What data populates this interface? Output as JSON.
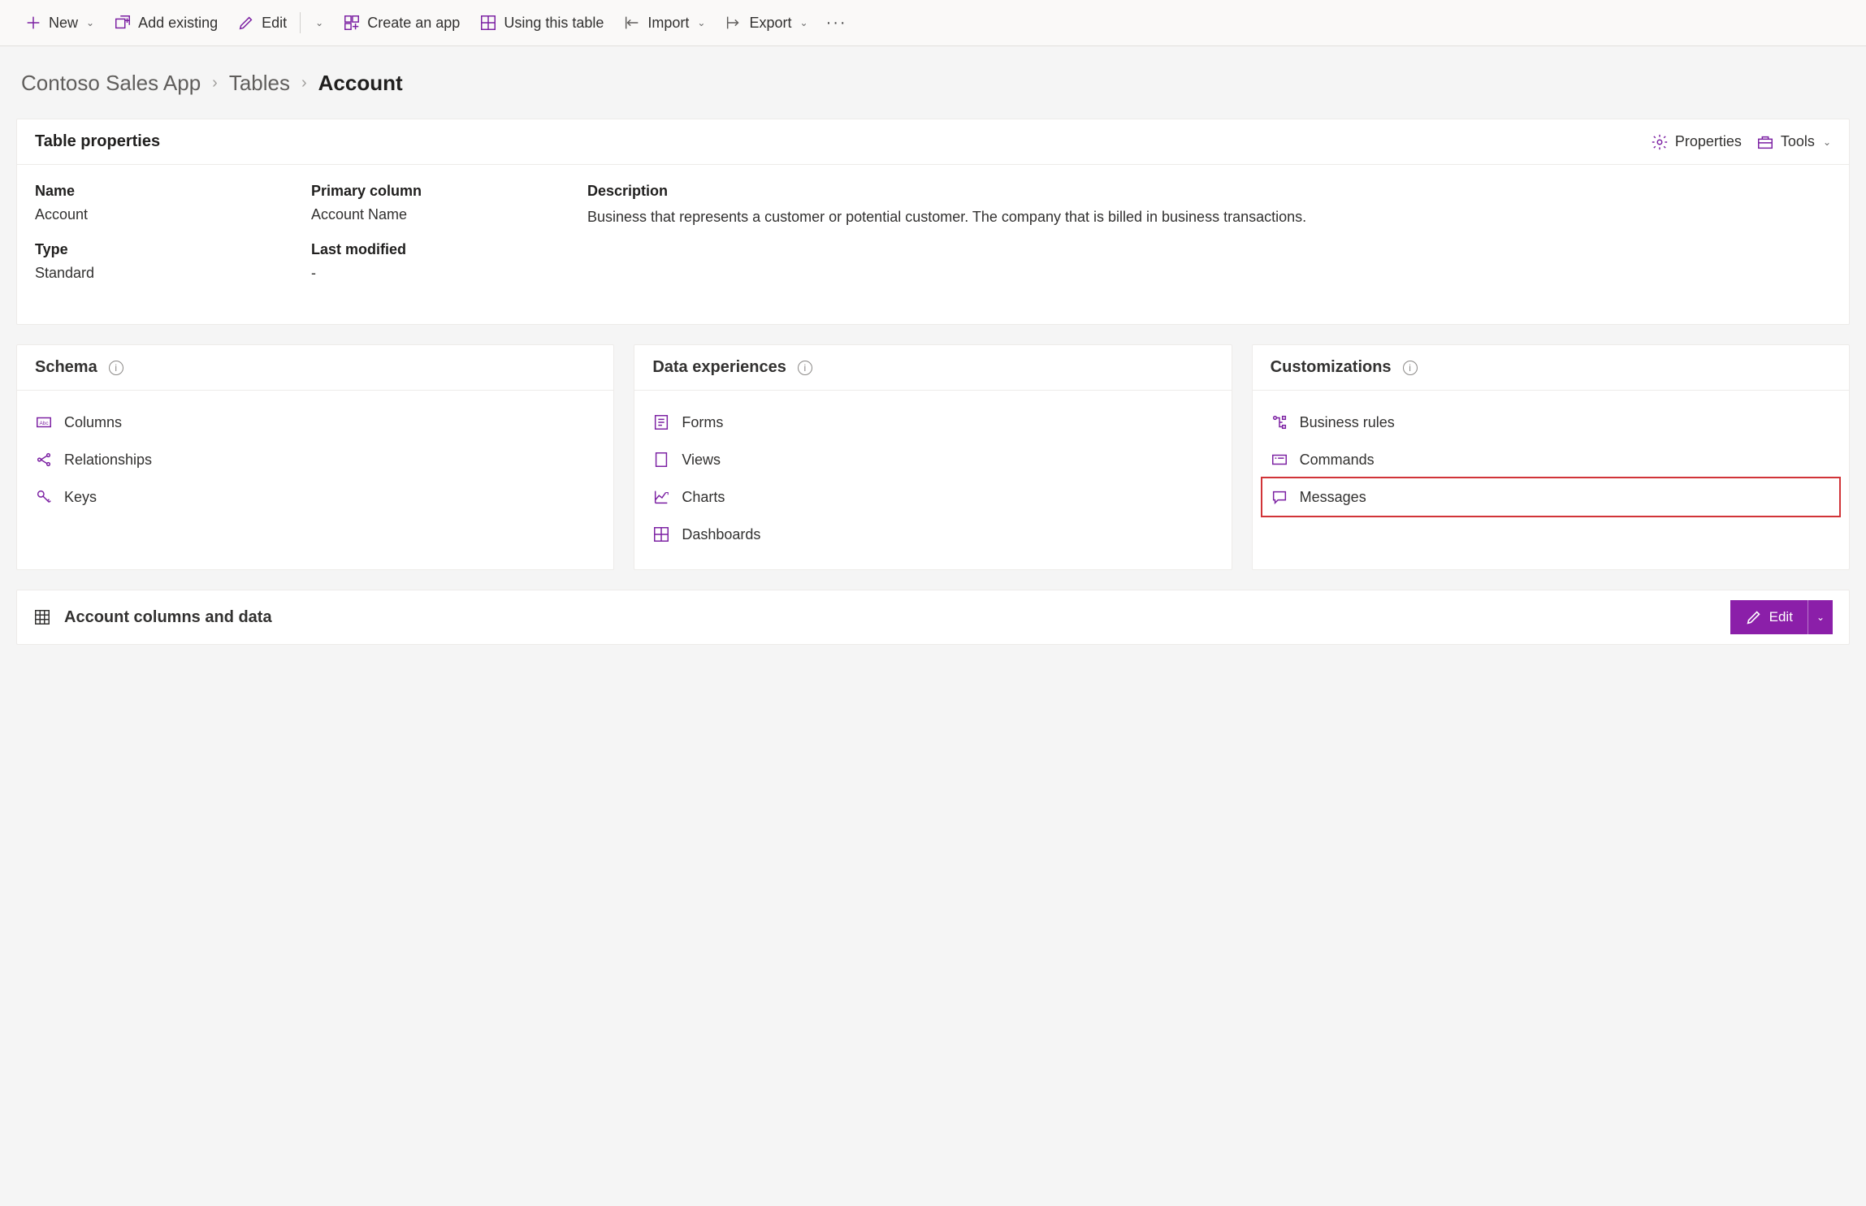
{
  "toolbar": {
    "new": "New",
    "add_existing": "Add existing",
    "edit": "Edit",
    "create_app": "Create an app",
    "using_table": "Using this table",
    "import": "Import",
    "export": "Export"
  },
  "breadcrumb": {
    "root": "Contoso Sales App",
    "mid": "Tables",
    "current": "Account"
  },
  "props_card": {
    "title": "Table properties",
    "properties_btn": "Properties",
    "tools_btn": "Tools",
    "name_label": "Name",
    "name_value": "Account",
    "type_label": "Type",
    "type_value": "Standard",
    "primary_label": "Primary column",
    "primary_value": "Account Name",
    "modified_label": "Last modified",
    "modified_value": "-",
    "desc_label": "Description",
    "desc_value": "Business that represents a customer or potential customer. The company that is billed in business transactions."
  },
  "schema": {
    "title": "Schema",
    "columns": "Columns",
    "relationships": "Relationships",
    "keys": "Keys"
  },
  "data_exp": {
    "title": "Data experiences",
    "forms": "Forms",
    "views": "Views",
    "charts": "Charts",
    "dashboards": "Dashboards"
  },
  "custom": {
    "title": "Customizations",
    "business_rules": "Business rules",
    "commands": "Commands",
    "messages": "Messages"
  },
  "bottom": {
    "title": "Account columns and data",
    "edit": "Edit"
  }
}
